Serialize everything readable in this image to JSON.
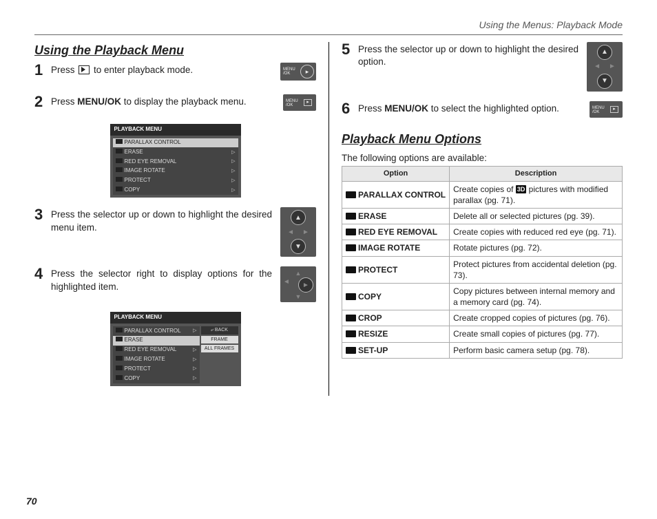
{
  "running_head": "Using the Menus: Playback Mode",
  "page_number": "70",
  "left": {
    "heading": "Using the Playback Menu",
    "s1_a": "Press ",
    "s1_b": " to enter playback mode.",
    "s2_a": "Press ",
    "s2_bold": "MENU/OK",
    "s2_b": " to display the play­back menu.",
    "s3": "Press the selector up or down to highlight the desired menu item.",
    "s4": "Press the selector right to display op­tions for the highlighted item.",
    "menu_ok_label": "MENU\n/OK"
  },
  "right": {
    "s5": "Press the selector up or down to highlight the desired option.",
    "s6_a": "Press ",
    "s6_bold": "MENU/OK",
    "s6_b": " to select the high­lighted option.",
    "heading": "Playback Menu Options",
    "intro": "The following options are available:",
    "th_option": "Option",
    "th_desc": "Description"
  },
  "menu1": {
    "title": "PLAYBACK MENU",
    "items": [
      "PARALLAX CONTROL",
      "ERASE",
      "RED EYE REMOVAL",
      "IMAGE ROTATE",
      "PROTECT",
      "COPY"
    ],
    "selected": 0
  },
  "menu2": {
    "title": "PLAYBACK MENU",
    "items": [
      "PARALLAX CONTROL",
      "ERASE",
      "RED EYE REMOVAL",
      "IMAGE ROTATE",
      "PROTECT",
      "COPY"
    ],
    "selected": 1,
    "side": [
      "BACK",
      "FRAME",
      "ALL FRAMES"
    ]
  },
  "options": [
    {
      "name": "PARALLAX CONTROL",
      "desc_a": "Create copies of ",
      "desc_badge": "3D",
      "desc_b": " pictures with modified parallax (pg. 71)."
    },
    {
      "name": "ERASE",
      "desc": "Delete all or selected pictures (pg. 39)."
    },
    {
      "name": "RED EYE REMOVAL",
      "desc": "Create copies with reduced red eye (pg. 71)."
    },
    {
      "name": "IMAGE ROTATE",
      "desc": "Rotate pictures (pg. 72)."
    },
    {
      "name": "PROTECT",
      "desc": "Protect pictures from accidental dele­tion (pg. 73)."
    },
    {
      "name": "COPY",
      "desc": "Copy pictures between internal memo­ry and a memory card (pg. 74)."
    },
    {
      "name": "CROP",
      "desc": "Create cropped copies of pictures (pg. 76)."
    },
    {
      "name": "RESIZE",
      "desc": "Create small copies of pictures (pg. 77)."
    },
    {
      "name": "SET-UP",
      "desc": "Perform basic camera setup (pg. 78)."
    }
  ]
}
